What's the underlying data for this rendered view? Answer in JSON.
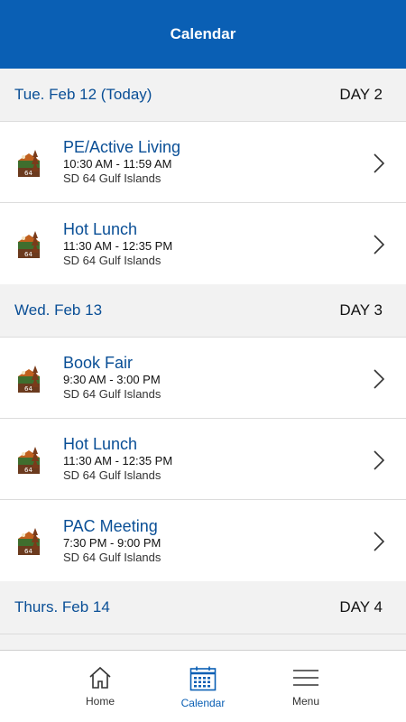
{
  "header": {
    "title": "Calendar"
  },
  "days": [
    {
      "date": "Tue. Feb 12 (Today)",
      "day_label": "DAY 2",
      "events": [
        {
          "title": "PE/Active Living",
          "time": "10:30 AM - 11:59 AM",
          "location": "SD 64 Gulf Islands"
        },
        {
          "title": "Hot Lunch",
          "time": "11:30 AM - 12:35 PM",
          "location": "SD 64 Gulf Islands"
        }
      ]
    },
    {
      "date": "Wed. Feb 13",
      "day_label": "DAY 3",
      "events": [
        {
          "title": "Book Fair",
          "time": "9:30 AM - 3:00 PM",
          "location": "SD 64 Gulf Islands"
        },
        {
          "title": "Hot Lunch",
          "time": "11:30 AM - 12:35 PM",
          "location": "SD 64 Gulf Islands"
        },
        {
          "title": "PAC Meeting",
          "time": "7:30 PM - 9:00 PM",
          "location": "SD 64 Gulf Islands"
        }
      ]
    },
    {
      "date": "Thurs. Feb 14",
      "day_label": "DAY 4",
      "events": []
    }
  ],
  "tabbar": {
    "home_label": "Home",
    "calendar_label": "Calendar",
    "menu_label": "Menu"
  },
  "colors": {
    "brand_blue": "#0a5fb4",
    "link_blue": "#0a4f96"
  },
  "icons": {
    "event_logo": "sd64-logo-icon",
    "chevron": "chevron-right-icon",
    "home": "home-icon",
    "calendar": "calendar-icon",
    "menu": "hamburger-menu-icon"
  }
}
